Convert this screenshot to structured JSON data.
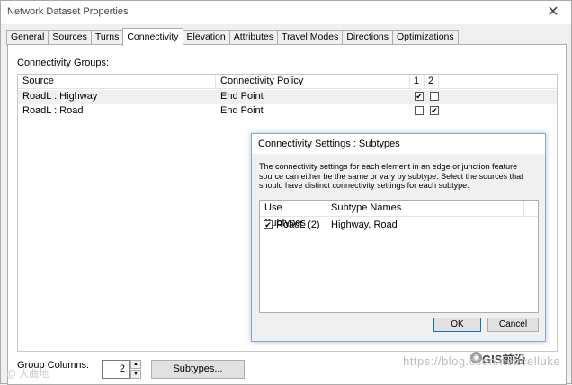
{
  "window": {
    "title": "Network Dataset Properties",
    "close_glyph": "✕"
  },
  "tabs": [
    {
      "label": "General"
    },
    {
      "label": "Sources"
    },
    {
      "label": "Turns"
    },
    {
      "label": "Connectivity"
    },
    {
      "label": "Elevation"
    },
    {
      "label": "Attributes"
    },
    {
      "label": "Travel Modes"
    },
    {
      "label": "Directions"
    },
    {
      "label": "Optimizations"
    }
  ],
  "connectivity": {
    "groups_label": "Connectivity Groups:",
    "columns": {
      "source": "Source",
      "policy": "Connectivity Policy",
      "g1": "1",
      "g2": "2"
    },
    "rows": [
      {
        "source": "RoadL : Highway",
        "policy": "End Point",
        "g1": true,
        "g2": false
      },
      {
        "source": "RoadL : Road",
        "policy": "End Point",
        "g1": false,
        "g2": true
      }
    ],
    "group_columns_label": "Group Columns:",
    "group_columns_value": "2",
    "subtypes_button": "Subtypes..."
  },
  "dialog": {
    "title": "Connectivity Settings : Subtypes",
    "description": "The connectivity settings for each element in an edge or junction feature source can either be the same or vary by subtype. Select the sources that should have distinct connectivity settings for each subtype.",
    "columns": {
      "use": "Use Subtypes",
      "names": "Subtype Names"
    },
    "rows": [
      {
        "source": "RoadL (2)",
        "names": "Highway, Road",
        "checked": true
      }
    ],
    "ok_label": "OK",
    "cancel_label": "Cancel"
  },
  "watermark": {
    "url": "https://blog.csdn.net/celluke",
    "brand": "GIS前沿",
    "logo_text": "@ 大曲地"
  },
  "colors": {
    "accent": "#7fa9d6",
    "selection": "#f0f0f0",
    "ok_border": "#0078d7"
  }
}
